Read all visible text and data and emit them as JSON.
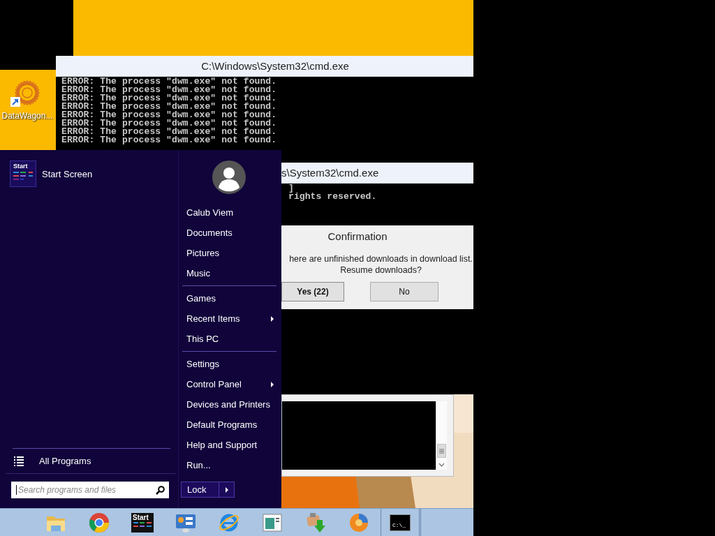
{
  "desktop_icons": [
    {
      "label": "DataWagon..."
    }
  ],
  "windows": [
    {
      "kind": "console",
      "title": "C:\\Windows\\System32\\cmd.exe",
      "lines": [
        "ERROR: The process \"dwm.exe\" not found.",
        "ERROR: The process \"dwm.exe\" not found.",
        "ERROR: The process \"dwm.exe\" not found.",
        "ERROR: The process \"dwm.exe\" not found.",
        "ERROR: The process \"dwm.exe\" not found.",
        "ERROR: The process \"dwm.exe\" not found.",
        "ERROR: The process \"dwm.exe\" not found.",
        "ERROR: The process \"dwm.exe\" not found."
      ]
    },
    {
      "kind": "console",
      "title": "s\\System32\\cmd.exe",
      "lines": [
        "]",
        "rights reserved."
      ]
    },
    {
      "kind": "panel"
    }
  ],
  "dialog": {
    "title": "Confirmation",
    "message": [
      "here are unfinished downloads in download list.",
      "Resume downloads?"
    ],
    "buttons": [
      {
        "label": "Yes (22)",
        "default": true
      },
      {
        "label": "No",
        "default": false
      }
    ]
  },
  "start_menu": {
    "pinned": [
      {
        "label": "Start Screen",
        "tile_text": "Start"
      }
    ],
    "all_programs": "All Programs",
    "search": {
      "placeholder": "Search programs and files"
    },
    "groups": [
      {
        "items": [
          {
            "label": "Calub Viem",
            "submenu": false
          },
          {
            "label": "Documents",
            "submenu": false
          },
          {
            "label": "Pictures",
            "submenu": false
          },
          {
            "label": "Music",
            "submenu": false
          }
        ]
      },
      {
        "items": [
          {
            "label": "Games",
            "submenu": false
          },
          {
            "label": "Recent Items",
            "submenu": true
          },
          {
            "label": "This PC",
            "submenu": false
          }
        ]
      },
      {
        "items": [
          {
            "label": "Settings",
            "submenu": false
          },
          {
            "label": "Control Panel",
            "submenu": true
          },
          {
            "label": "Devices and Printers",
            "submenu": false
          },
          {
            "label": "Default Programs",
            "submenu": false
          },
          {
            "label": "Help and Support",
            "submenu": false
          },
          {
            "label": "Run...",
            "submenu": false
          }
        ]
      }
    ],
    "power_button": "Lock"
  },
  "taskbar": {
    "items": [
      {
        "kind": "folder"
      },
      {
        "kind": "chrome"
      },
      {
        "kind": "start",
        "label": "Start"
      },
      {
        "kind": "control"
      },
      {
        "kind": "globe"
      },
      {
        "kind": "window"
      },
      {
        "kind": "download"
      },
      {
        "kind": "swirl"
      },
      {
        "kind": "console",
        "label": "C:\\_"
      }
    ]
  }
}
